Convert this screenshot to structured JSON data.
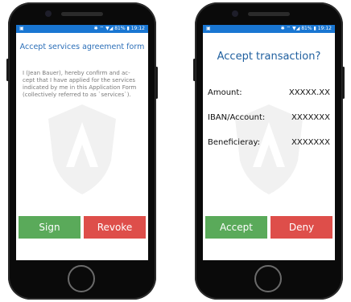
{
  "status_bar": {
    "left_icon": "image-notification-icon",
    "right_text": "✱ ⌔ ▼◢ 81% ▮ 19:12"
  },
  "screen1": {
    "title": "Accept services agreement form",
    "body": "I (Jean Bauer), hereby confirm and ac-\ncept that I have applied for the services\nindicated by me in this Application Form\n(collectively referred to as `services`).",
    "sign_label": "Sign",
    "revoke_label": "Revoke"
  },
  "screen2": {
    "title": "Accept transaction?",
    "rows": [
      {
        "label": "Amount:",
        "value": "XXXXX.XX"
      },
      {
        "label": "IBAN/Account:",
        "value": "XXXXXXX"
      },
      {
        "label": "Beneficieray:",
        "value": "XXXXXXX"
      }
    ],
    "accept_label": "Accept",
    "deny_label": "Deny"
  },
  "colors": {
    "status_bar": "#1976d2",
    "title": "#2c6fb8",
    "accept": "#5aaa5a",
    "deny": "#de4e4a"
  }
}
